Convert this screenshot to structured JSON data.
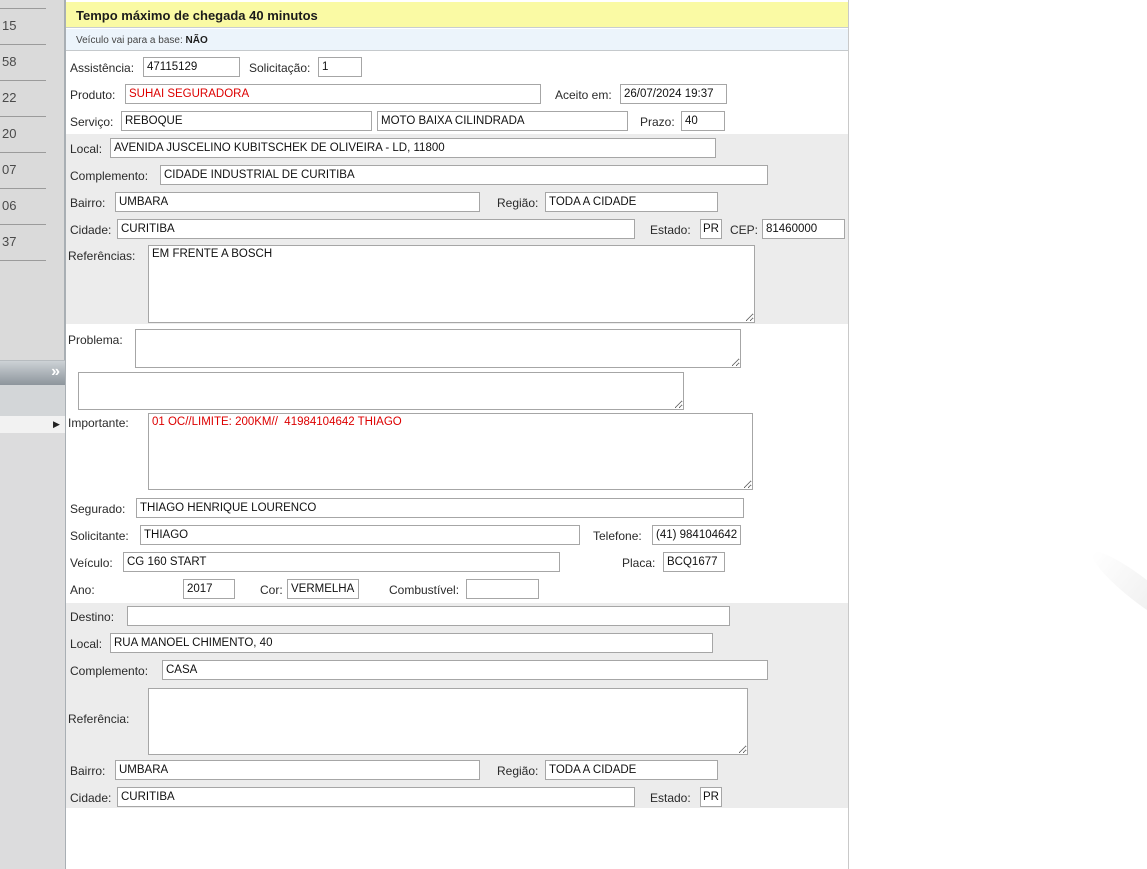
{
  "header": {
    "title": "Tempo máximo de chegada 40 minutos",
    "base_label": "Veículo vai para a base:",
    "base_value": "NÃO"
  },
  "sidebar": {
    "times": [
      "15",
      "58",
      "22",
      "20",
      "07",
      "06",
      "37"
    ],
    "collapse_icon": "»",
    "row_expand_icon": "▶"
  },
  "form": {
    "assistencia": {
      "label": "Assistência:",
      "value": "47115129"
    },
    "solicitacao": {
      "label": "Solicitação:",
      "value": "1"
    },
    "produto": {
      "label": "Produto:",
      "value": "SUHAI SEGURADORA"
    },
    "aceito_em": {
      "label": "Aceito em:",
      "value": "26/07/2024 19:37"
    },
    "servico": {
      "label": "Serviço:",
      "value": "REBOQUE"
    },
    "servico_tipo": {
      "value": "MOTO BAIXA CILINDRADA"
    },
    "prazo": {
      "label": "Prazo:",
      "value": "40"
    },
    "local": {
      "label": "Local:",
      "value": "AVENIDA JUSCELINO KUBITSCHEK DE OLIVEIRA - LD, 11800"
    },
    "complemento": {
      "label": "Complemento:",
      "value": "CIDADE INDUSTRIAL DE CURITIBA"
    },
    "bairro": {
      "label": "Bairro:",
      "value": "UMBARA"
    },
    "regiao": {
      "label": "Região:",
      "value": "TODA A CIDADE"
    },
    "cidade": {
      "label": "Cidade:",
      "value": "CURITIBA"
    },
    "estado": {
      "label": "Estado:",
      "value": "PR"
    },
    "cep": {
      "label": "CEP:",
      "value": "81460000"
    },
    "referencias": {
      "label": "Referências:",
      "value": "EM FRENTE A BOSCH"
    },
    "problema": {
      "label": "Problema:",
      "value": ""
    },
    "observacao_extra": {
      "value": ""
    },
    "importante": {
      "label": "Importante:",
      "value": "01 OC//LIMITE: 200KM//  41984104642 THIAGO"
    },
    "segurado": {
      "label": "Segurado:",
      "value": "THIAGO HENRIQUE LOURENCO"
    },
    "solicitante": {
      "label": "Solicitante:",
      "value": "THIAGO"
    },
    "telefone": {
      "label": "Telefone:",
      "value": "(41) 984104642"
    },
    "veiculo": {
      "label": "Veículo:",
      "value": "CG 160 START"
    },
    "placa": {
      "label": "Placa:",
      "value": "BCQ1677"
    },
    "ano": {
      "label": "Ano:",
      "value": "2017"
    },
    "cor": {
      "label": "Cor:",
      "value": "VERMELHA"
    },
    "combustivel": {
      "label": "Combustível:",
      "value": ""
    },
    "destino": {
      "label": "Destino:",
      "value": ""
    },
    "destino_local": {
      "label": "Local:",
      "value": "RUA MANOEL CHIMENTO, 40"
    },
    "destino_complemento": {
      "label": "Complemento:",
      "value": "CASA"
    },
    "destino_referencia": {
      "label": "Referência:",
      "value": ""
    },
    "destino_bairro": {
      "label": "Bairro:",
      "value": "UMBARA"
    },
    "destino_regiao": {
      "label": "Região:",
      "value": "TODA A CIDADE"
    },
    "destino_cidade": {
      "label": "Cidade:",
      "value": "CURITIBA"
    },
    "destino_estado": {
      "label": "Estado:",
      "value": "PR"
    }
  },
  "colors": {
    "title_bg": "#fafaa4",
    "base_bar_bg": "#ecf4fb",
    "section_gray": "#ececec",
    "alert_red": "#dd0000"
  }
}
